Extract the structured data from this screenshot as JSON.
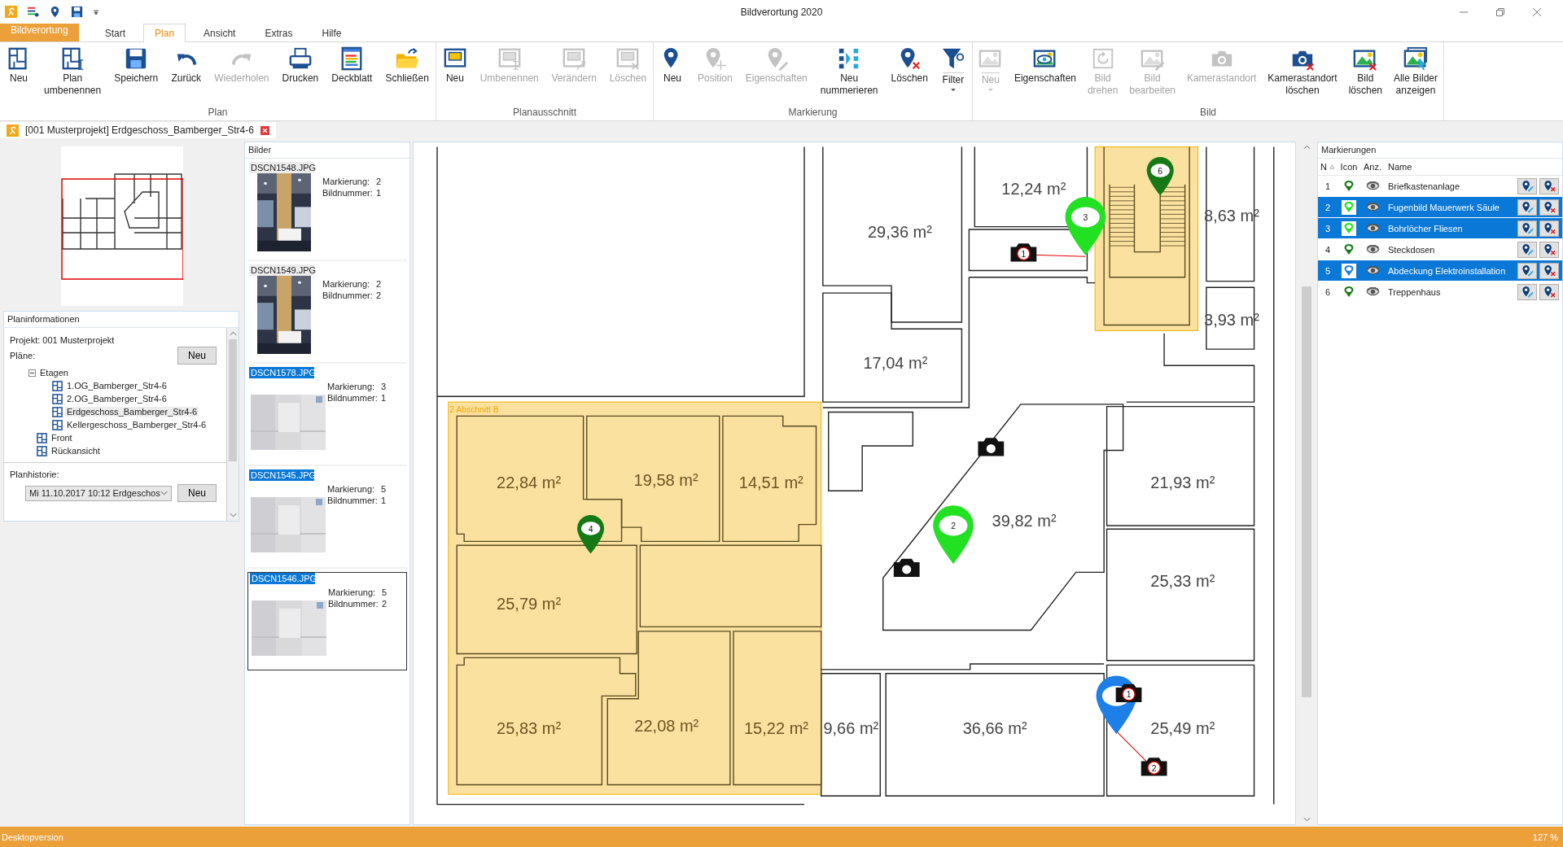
{
  "window": {
    "title": "Bildverortung 2020"
  },
  "ribbon_tabs": [
    {
      "label": "Bildverortung",
      "kind": "app",
      "selected": false
    },
    {
      "label": "Start",
      "kind": "tab",
      "selected": false
    },
    {
      "label": "Plan",
      "kind": "tab",
      "selected": true
    },
    {
      "label": "Ansicht",
      "kind": "tab",
      "selected": false
    },
    {
      "label": "Extras",
      "kind": "tab",
      "selected": false
    },
    {
      "label": "Hilfe",
      "kind": "tab",
      "selected": false
    }
  ],
  "ribbon_groups": [
    {
      "label": "Plan",
      "buttons": [
        {
          "label": "Neu",
          "disabled": false
        },
        {
          "label": "Plan\numbenennen",
          "disabled": false
        },
        {
          "label": "Speichern",
          "disabled": false
        },
        {
          "label": "Zurück",
          "disabled": false
        },
        {
          "label": "Wiederholen",
          "disabled": true
        },
        {
          "label": "Drucken",
          "disabled": false
        },
        {
          "label": "Deckblatt",
          "disabled": false
        },
        {
          "label": "Schließen",
          "disabled": false
        }
      ]
    },
    {
      "label": "Planausschnitt",
      "buttons": [
        {
          "label": "Neu",
          "disabled": false
        },
        {
          "label": "Umbenennen",
          "disabled": true
        },
        {
          "label": "Verändern",
          "disabled": true
        },
        {
          "label": "Löschen",
          "disabled": true
        }
      ]
    },
    {
      "label": "Markierung",
      "buttons": [
        {
          "label": "Neu",
          "disabled": false
        },
        {
          "label": "Position",
          "disabled": true
        },
        {
          "label": "Eigenschaften",
          "disabled": true
        },
        {
          "label": "Neu\nnummerieren",
          "disabled": false
        },
        {
          "label": "Löschen",
          "disabled": false
        },
        {
          "label": "Filter",
          "disabled": false,
          "dropdown": true
        }
      ]
    },
    {
      "label": "Bild",
      "buttons": [
        {
          "label": "Neu",
          "disabled": true,
          "dropdown": true
        },
        {
          "label": "Eigenschaften",
          "disabled": false
        },
        {
          "label": "Bild\ndrehen",
          "disabled": true
        },
        {
          "label": "Bild\nbearbeiten",
          "disabled": true
        },
        {
          "label": "Kamerastandort",
          "disabled": true
        },
        {
          "label": "Kamerastandort\nlöschen",
          "disabled": false
        },
        {
          "label": "Bild\nlöschen",
          "disabled": false
        },
        {
          "label": "Alle Bilder\nanzeigen",
          "disabled": false
        }
      ]
    }
  ],
  "document_tab": {
    "title": "[001 Musterprojekt] Erdgeschoss_Bamberger_Str4-6"
  },
  "plan_info": {
    "title": "Planinformationen",
    "project": "Projekt: 001 Musterprojekt",
    "plans_label": "Pläne:",
    "new_button": "Neu",
    "tree": [
      {
        "label": "Etagen",
        "expanded": true,
        "children": [
          {
            "label": "1.OG_Bamberger_Str4-6",
            "selected": false
          },
          {
            "label": "2.OG_Bamberger_Str4-6",
            "selected": false
          },
          {
            "label": "Erdgeschoss_Bamberger_Str4-6",
            "selected": true
          },
          {
            "label": "Kellergeschoss_Bamberger_Str4-6",
            "selected": false
          }
        ]
      },
      {
        "label": "Front",
        "selected": false
      },
      {
        "label": "Rückansicht",
        "selected": false
      }
    ],
    "history_label": "Planhistorie:",
    "history_value": "Mi 11.10.2017 10:12 Erdgeschos",
    "history_button": "Neu"
  },
  "images": {
    "title": "Bilder",
    "items": [
      {
        "file": "DSCN1548.JPG",
        "selected": false,
        "marker_label": "Markierung:",
        "marker": "2",
        "number_label": "Bildnummer:",
        "number": "1"
      },
      {
        "file": "DSCN1549.JPG",
        "selected": false,
        "marker_label": "Markierung:",
        "marker": "2",
        "number_label": "Bildnummer:",
        "number": "2"
      },
      {
        "file": "DSCN1578.JPG",
        "selected": true,
        "marker_label": "Markierung:",
        "marker": "3",
        "number_label": "Bildnummer:",
        "number": "1"
      },
      {
        "file": "DSCN1545.JPG",
        "selected": true,
        "marker_label": "Markierung:",
        "marker": "5",
        "number_label": "Bildnummer:",
        "number": "1"
      },
      {
        "file": "DSCN1546.JPG",
        "selected": true,
        "marker_label": "Markierung:",
        "marker": "5",
        "number_label": "Bildnummer:",
        "number": "2"
      }
    ]
  },
  "plan": {
    "section_label": "2 Abschnitt B",
    "rooms": [
      {
        "area": "29,36 m²"
      },
      {
        "area": "12,24 m²"
      },
      {
        "area": "8,63 m²"
      },
      {
        "area": "3,93 m²"
      },
      {
        "area": "17,04 m²"
      },
      {
        "area": "22,84 m²"
      },
      {
        "area": "19,58 m²"
      },
      {
        "area": "14,51 m²"
      },
      {
        "area": "39,82 m²"
      },
      {
        "area": "21,93 m²"
      },
      {
        "area": "25,79 m²"
      },
      {
        "area": "25,33 m²"
      },
      {
        "area": "25,83 m²"
      },
      {
        "area": "22,08 m²"
      },
      {
        "area": "15,22 m²"
      },
      {
        "area": "9,66 m²"
      },
      {
        "area": "36,66 m²"
      },
      {
        "area": "25,49 m²"
      }
    ],
    "pins": [
      {
        "number": "6",
        "color": "#157a15",
        "selected": false
      },
      {
        "number": "3",
        "color": "#22e022",
        "selected": true
      },
      {
        "number": "4",
        "color": "#157a15",
        "selected": false
      },
      {
        "number": "2",
        "color": "#22e022",
        "selected": true
      },
      {
        "color": "#1e7fe8",
        "selected": true
      }
    ],
    "cameras": [
      {
        "number": "1"
      },
      {
        "number": "1"
      },
      {
        "number": "2"
      }
    ]
  },
  "markers_panel": {
    "title": "Markierungen",
    "columns": [
      "N",
      "Icon",
      "Anz.",
      "Name"
    ],
    "rows": [
      {
        "number": "1",
        "color": "#157a15",
        "name": "Briefkastenanlage",
        "selected": false
      },
      {
        "number": "2",
        "color": "#22e022",
        "name": "Fugenbild Mauerwerk Säule",
        "selected": true
      },
      {
        "number": "3",
        "color": "#22e022",
        "name": "Bohrlöcher Fliesen",
        "selected": true
      },
      {
        "number": "4",
        "color": "#157a15",
        "name": "Steckdosen",
        "selected": false
      },
      {
        "number": "5",
        "color": "#1e7fe8",
        "name": "Abdeckung Elektroinstallation",
        "selected": true
      },
      {
        "number": "6",
        "color": "#157a15",
        "name": "Treppenhaus",
        "selected": false
      }
    ]
  },
  "status_bar": {
    "left": "Desktopversion",
    "zoom": "127 %"
  }
}
